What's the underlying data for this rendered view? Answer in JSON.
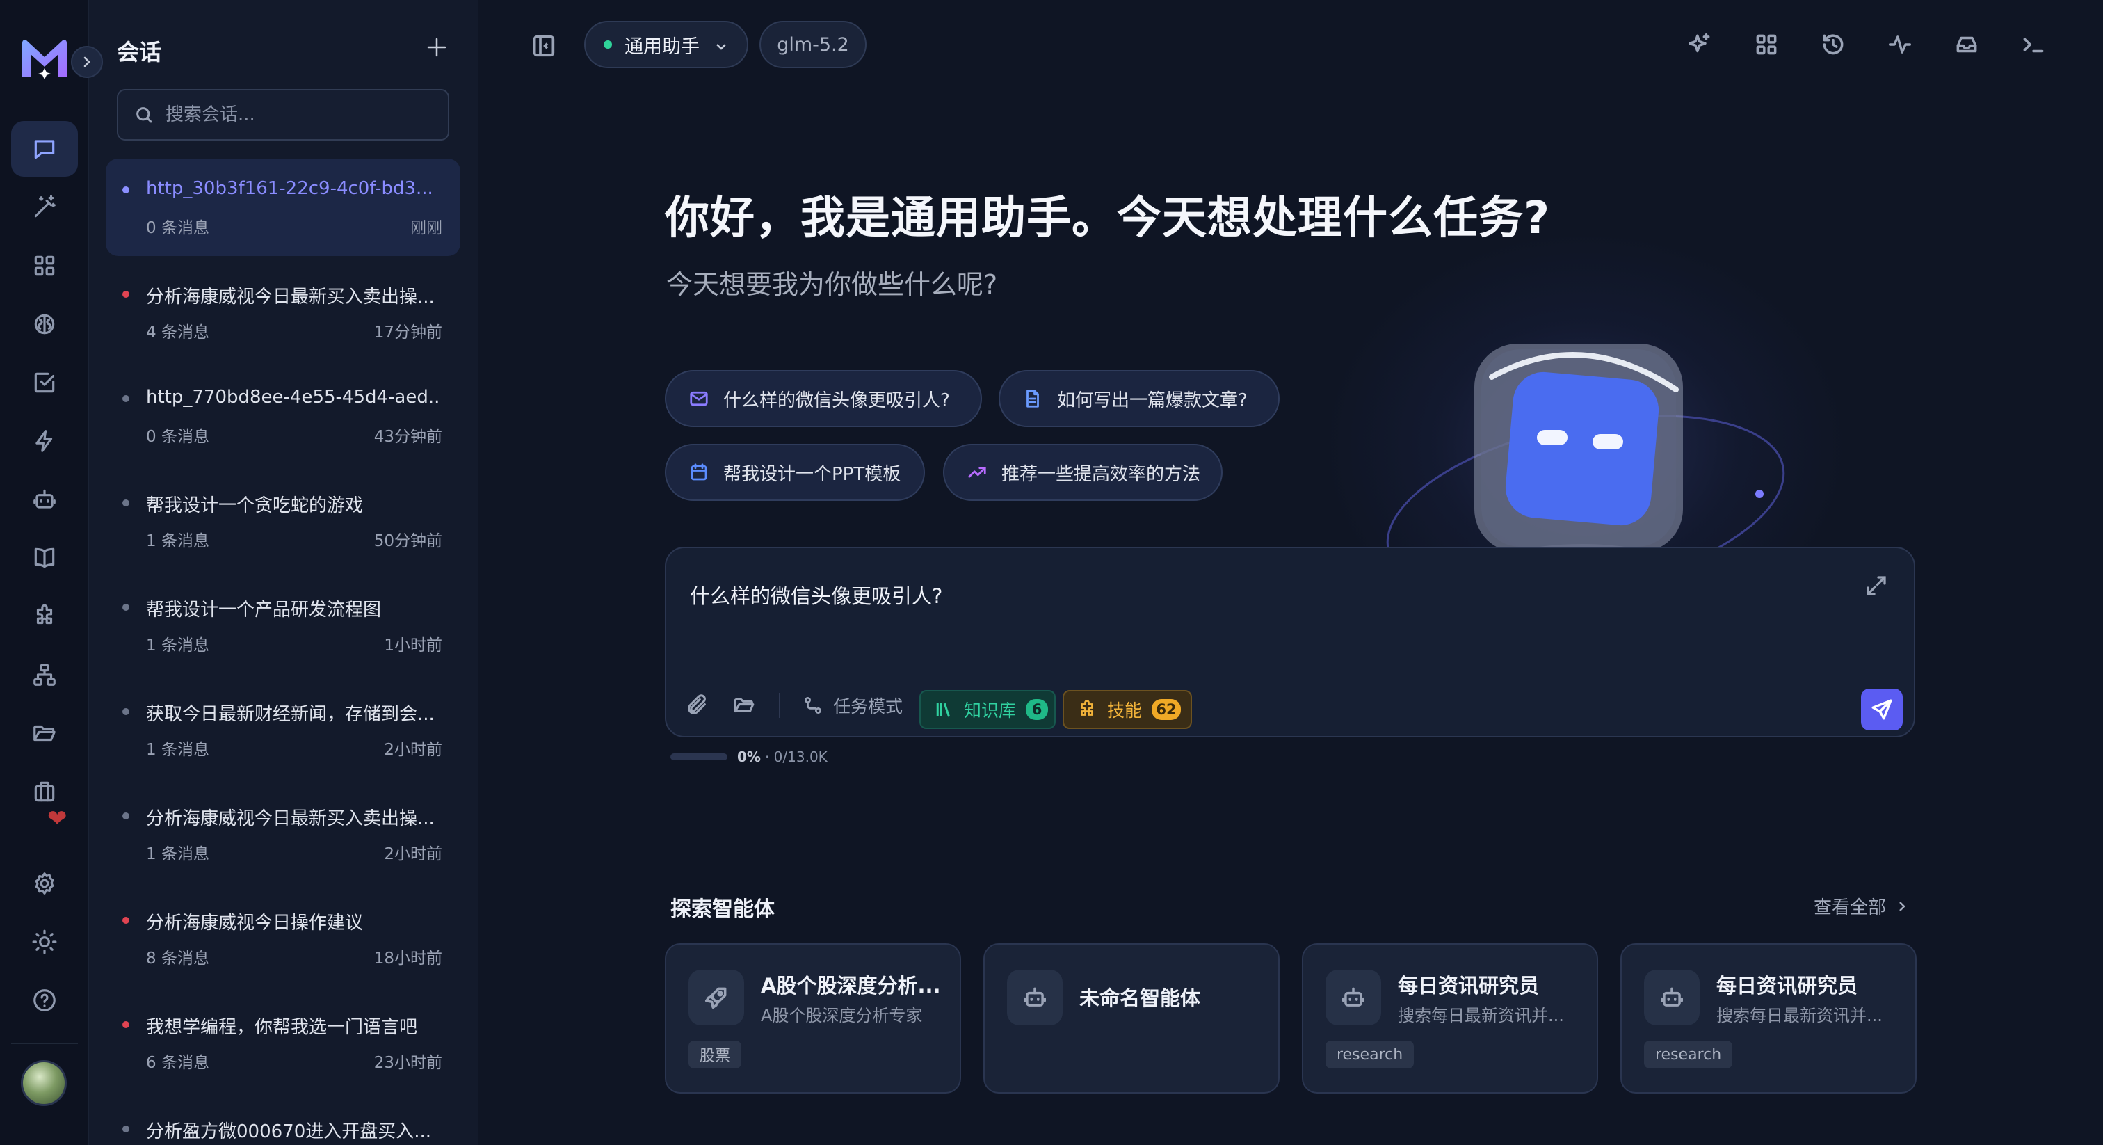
{
  "sidebar": {
    "title": "会话",
    "search_placeholder": "搜索会话...",
    "conversations": [
      {
        "title": "http_30b3f161-22c9-4c0f-bd3...",
        "count": "0 条消息",
        "time": "刚刚",
        "dot": "blue"
      },
      {
        "title": "分析海康威视今日最新买入卖出操...",
        "count": "4 条消息",
        "time": "17分钟前",
        "dot": "red"
      },
      {
        "title": "http_770bd8ee-4e55-45d4-aed...",
        "count": "0 条消息",
        "time": "43分钟前",
        "dot": "gray"
      },
      {
        "title": "帮我设计一个贪吃蛇的游戏",
        "count": "1 条消息",
        "time": "50分钟前",
        "dot": "gray"
      },
      {
        "title": "帮我设计一个产品研发流程图",
        "count": "1 条消息",
        "time": "1小时前",
        "dot": "gray"
      },
      {
        "title": "获取今日最新财经新闻，存储到会...",
        "count": "1 条消息",
        "time": "2小时前",
        "dot": "gray"
      },
      {
        "title": "分析海康威视今日最新买入卖出操...",
        "count": "1 条消息",
        "time": "2小时前",
        "dot": "gray"
      },
      {
        "title": "分析海康威视今日操作建议",
        "count": "8 条消息",
        "time": "18小时前",
        "dot": "red"
      },
      {
        "title": "我想学编程，你帮我选一门语言吧",
        "count": "6 条消息",
        "time": "23小时前",
        "dot": "red"
      },
      {
        "title": "分析盈方微000670进入开盘买入...",
        "count": "",
        "time": "",
        "dot": "gray"
      }
    ]
  },
  "topbar": {
    "agent_label": "通用助手",
    "model_label": "glm-5.2"
  },
  "hero": {
    "title": "你好，我是通用助手。今天想处理什么任务?",
    "subtitle": "今天想要我为你做些什么呢?"
  },
  "suggestions": [
    {
      "label": "什么样的微信头像更吸引人?",
      "icon": "mail-icon"
    },
    {
      "label": "如何写出一篇爆款文章?",
      "icon": "document-icon"
    },
    {
      "label": "帮我设计一个PPT模板",
      "icon": "calendar-icon"
    },
    {
      "label": "推荐一些提高效率的方法",
      "icon": "trending-up-icon"
    }
  ],
  "composer": {
    "text": "什么样的微信头像更吸引人?",
    "task_mode": "任务模式",
    "knowledge_label": "知识库",
    "knowledge_count": "6",
    "skills_label": "技能",
    "skills_count": "62"
  },
  "usage": {
    "percent": "0%",
    "detail": "· 0/13.0K",
    "fraction": 0
  },
  "explore": {
    "title": "探索智能体",
    "view_all": "查看全部",
    "cards": [
      {
        "name": "A股个股深度分析...",
        "desc": "A股个股深度分析专家",
        "tag": "股票",
        "icon": "rocket-icon"
      },
      {
        "name": "未命名智能体",
        "desc": "",
        "tag": "",
        "icon": "bot-icon"
      },
      {
        "name": "每日资讯研究员",
        "desc": "搜索每日最新资讯并...",
        "tag": "research",
        "icon": "bot-icon"
      },
      {
        "name": "每日资讯研究员",
        "desc": "搜索每日最新资讯并...",
        "tag": "research",
        "icon": "bot-icon"
      }
    ]
  },
  "colors": {
    "accent": "#5b5cf2",
    "green": "#30d1a0",
    "amber": "#f3b43a",
    "red_dot": "#e04452"
  }
}
